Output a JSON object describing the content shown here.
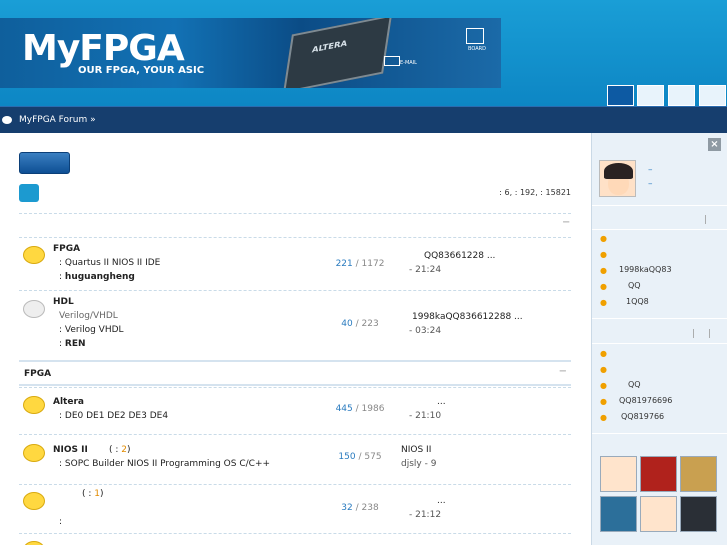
{
  "banner": {
    "logo": "MyFPGA",
    "slogan": "OUR FPGA, YOUR ASIC",
    "chip_label": "ALTERA",
    "icon1_label": "BOARD",
    "icon2_label": "E-MAIL"
  },
  "navbar": {
    "breadcrumb": "MyFPGA Forum »"
  },
  "stats": ": 6,  : 192,  : 15821",
  "sections": [
    {
      "forums": [
        {
          "name": "FPGA",
          "desc": "",
          "mod_line": ": Quartus II  NIOS II IDE",
          "mods": "huguangheng",
          "topics": "221",
          "posts": "1172",
          "last_title": "QQ83661228 ...",
          "last_meta": "-   21:24"
        },
        {
          "name": "HDL",
          "desc": "Verilog/VHDL",
          "mod_line": ": Verilog  VHDL",
          "mods": "REN",
          "topics": "40",
          "posts": "223",
          "last_title": "1998kaQQ836612288 ...",
          "last_meta": "-   03:24"
        }
      ]
    },
    {
      "title": "FPGA",
      "collapse": "−",
      "forums": [
        {
          "name": "Altera",
          "mod_line": ": DE0  DE1  DE2  DE3  DE4",
          "topics": "445",
          "posts": "1986",
          "last_title": "...",
          "last_meta": "-   21:10"
        },
        {
          "name": "NIOS II",
          "badge_open": "(",
          "badge_num": "2",
          "badge_close": ")",
          "mod_line": ": SOPC Builder  NIOS II Programming  OS  C/C++",
          "topics": "150",
          "posts": "575",
          "last_title": "NIOS II",
          "last_meta": "djsly - 9"
        },
        {
          "name": "",
          "badge_open": "(",
          "badge_num": "1",
          "badge_close": ")",
          "mod_line": ":",
          "topics": "32",
          "posts": "238",
          "last_title": "...",
          "last_meta": "-   21:12"
        }
      ]
    }
  ],
  "sidebar": {
    "close": "×",
    "links": [
      "–",
      "–"
    ],
    "list1": [
      "",
      "",
      "1998kaQQ83",
      "QQ",
      "1QQ8"
    ],
    "list2": [
      "",
      "",
      "QQ",
      "QQ81976696",
      "QQ819766"
    ]
  },
  "colors": {
    "header_bg": "#1a9ed6",
    "navbar_bg": "#163e6e",
    "link": "#2a7bbf",
    "bubble": "#ffd840",
    "bullet": "#f0a000"
  }
}
